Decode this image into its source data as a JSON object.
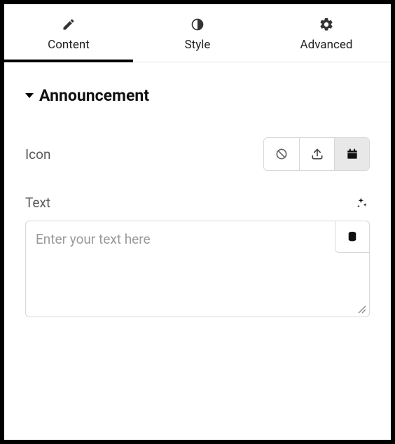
{
  "tabs": {
    "content": {
      "label": "Content",
      "active": true
    },
    "style": {
      "label": "Style",
      "active": false
    },
    "advanced": {
      "label": "Advanced",
      "active": false
    }
  },
  "section": {
    "title": "Announcement"
  },
  "fields": {
    "icon": {
      "label": "Icon",
      "options": {
        "none": "none",
        "upload": "upload",
        "library": "library"
      },
      "selected": "library"
    },
    "text": {
      "label": "Text",
      "placeholder": "Enter your text here",
      "value": ""
    }
  }
}
